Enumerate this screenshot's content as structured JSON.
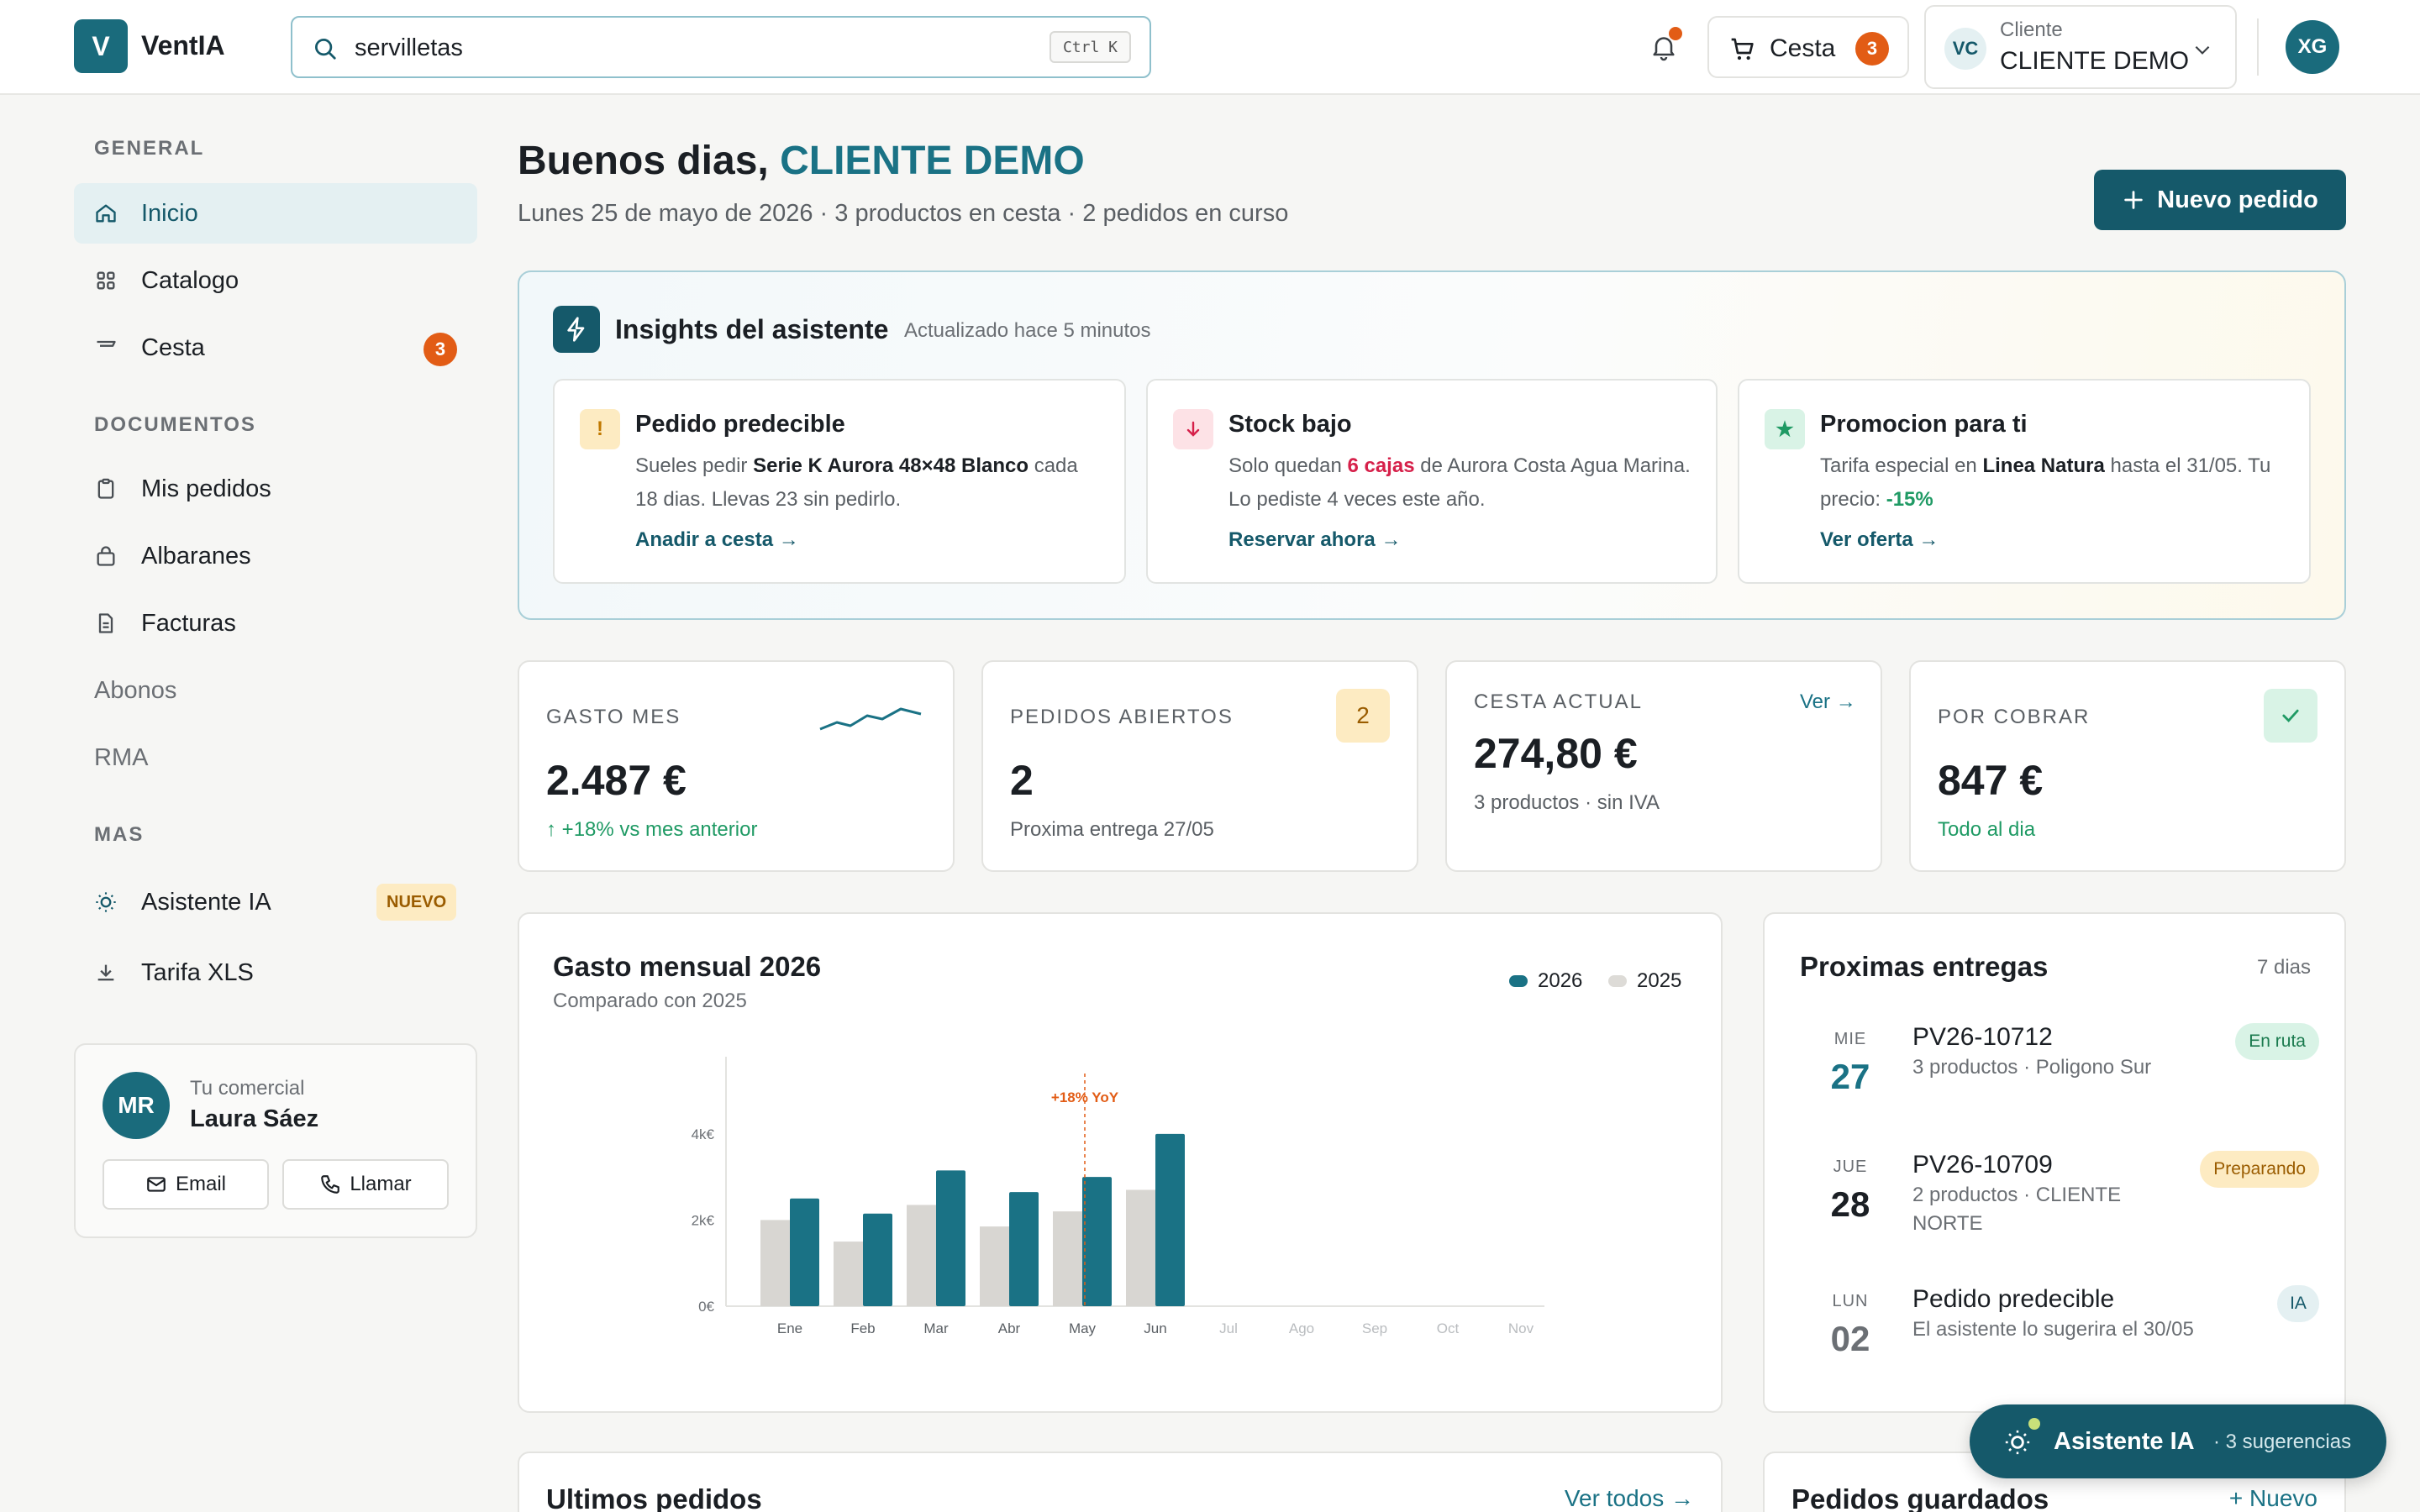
{
  "app": {
    "logo_letter": "V",
    "name": "VentIA"
  },
  "search": {
    "value": "servilletas",
    "shortcut": "Ctrl K"
  },
  "header": {
    "cart_label": "Cesta",
    "cart_count": "3",
    "client_initials": "VC",
    "client_caption": "Cliente",
    "client_name": "CLIENTE DEMO",
    "user_initials": "XG"
  },
  "sidebar": {
    "sections": [
      {
        "title": "GENERAL"
      },
      {
        "title": "DOCUMENTOS"
      },
      {
        "title": "MAS"
      }
    ],
    "items": [
      {
        "label": "Inicio",
        "icon": "home-icon"
      },
      {
        "label": "Catalogo",
        "icon": "grid-icon"
      },
      {
        "label": "Cesta",
        "icon": "basket-icon",
        "badge": "3"
      },
      {
        "label": "Mis pedidos",
        "icon": "clipboard-icon"
      },
      {
        "label": "Albaranes",
        "icon": "bag-icon"
      },
      {
        "label": "Facturas",
        "icon": "document-icon"
      },
      {
        "label": "Abonos"
      },
      {
        "label": "RMA"
      },
      {
        "label": "Asistente IA",
        "icon": "lightbulb-icon",
        "badge": "NUEVO"
      },
      {
        "label": "Tarifa XLS",
        "icon": "download-icon"
      }
    ],
    "sales_rep": {
      "initials": "MR",
      "caption": "Tu comercial",
      "name": "Laura Sáez",
      "email_label": "Email",
      "call_label": "Llamar"
    }
  },
  "greeting": {
    "hello": "Buenos dias,",
    "client": "CLIENTE DEMO",
    "subtitle": "Lunes 25 de mayo de 2026 · 3 productos en cesta · 2 pedidos en curso",
    "new_order_label": "Nuevo pedido"
  },
  "insights": {
    "title": "Insights del asistente",
    "updated": "Actualizado hace 5 minutos",
    "cards": [
      {
        "title": "Pedido predecible",
        "icon": "!",
        "t1": "Sueles pedir ",
        "b1": "Serie K Aurora 48×48 Blanco",
        "t2": " cada 18 dias. Llevas 23 sin pedirlo.",
        "link": "Anadir a cesta →"
      },
      {
        "title": "Stock bajo",
        "icon": "arrow-down-icon",
        "t1": "Solo quedan ",
        "b1": "6 cajas",
        "t2": " de Aurora Costa Agua Marina. Lo pediste 4 veces este año.",
        "link": "Reservar ahora →"
      },
      {
        "title": "Promocion para ti",
        "icon": "star-icon",
        "t1": "Tarifa especial en ",
        "b1": "Linea Natura",
        "t2": " hasta el 31/05. Tu precio: ",
        "b2": "-15%",
        "link": "Ver oferta →"
      }
    ]
  },
  "stats": [
    {
      "label": "GASTO MES",
      "value": "2.487 €",
      "sub": "+18% vs mes anterior"
    },
    {
      "label": "PEDIDOS ABIERTOS",
      "value": "2",
      "badge": "2",
      "sub": "Proxima entrega 27/05"
    },
    {
      "label": "CESTA ACTUAL",
      "value": "274,80 €",
      "link": "Ver →",
      "sub": "3 productos · sin IVA"
    },
    {
      "label": "POR COBRAR",
      "value": "847 €",
      "sub": "Todo al dia"
    }
  ],
  "chart_data": {
    "type": "bar",
    "title": "Gasto mensual 2026",
    "subtitle": "Comparado con 2025",
    "categories": [
      "Ene",
      "Feb",
      "Mar",
      "Abr",
      "May",
      "Jun",
      "Jul",
      "Ago",
      "Sep",
      "Oct",
      "Nov"
    ],
    "series": [
      {
        "name": "2025",
        "color": "#d8d6d2",
        "values": [
          2000,
          1500,
          2350,
          1850,
          2200,
          2700,
          null,
          null,
          null,
          null,
          null
        ]
      },
      {
        "name": "2026",
        "color": "#1a7285",
        "values": [
          2500,
          2150,
          3150,
          2650,
          3000,
          4000,
          null,
          null,
          null,
          null,
          null
        ]
      }
    ],
    "yticks": [
      "0€",
      "2k€",
      "4k€"
    ],
    "ylim": [
      0,
      5400
    ],
    "annotation": {
      "text": "+18% YoY",
      "category": "May"
    },
    "grid": false
  },
  "deliveries": {
    "title": "Proximas entregas",
    "range": "7 dias",
    "items": [
      {
        "dow": "MIE",
        "day": "27",
        "title": "PV26-10712",
        "sub": "3 productos · Poligono Sur",
        "tag": "En ruta"
      },
      {
        "dow": "JUE",
        "day": "28",
        "title": "PV26-10709",
        "sub": "2 productos · CLIENTE NORTE",
        "tag": "Preparando"
      },
      {
        "dow": "LUN",
        "day": "02",
        "title": "Pedido predecible",
        "sub": "El asistente lo sugerira el 30/05",
        "tag": "IA"
      }
    ]
  },
  "bottom": {
    "last_orders": "Ultimos pedidos",
    "see_all": "Ver todos →",
    "saved_orders": "Pedidos guardados",
    "new_saved": "+ Nuevo"
  },
  "assistant_fab": {
    "label": "Asistente IA",
    "suggestions": "· 3 sugerencias"
  },
  "colors": {
    "brand": "#1a6b7c",
    "accent_orange": "#e25c15",
    "green": "#1f9a64",
    "red": "#d6204a"
  }
}
